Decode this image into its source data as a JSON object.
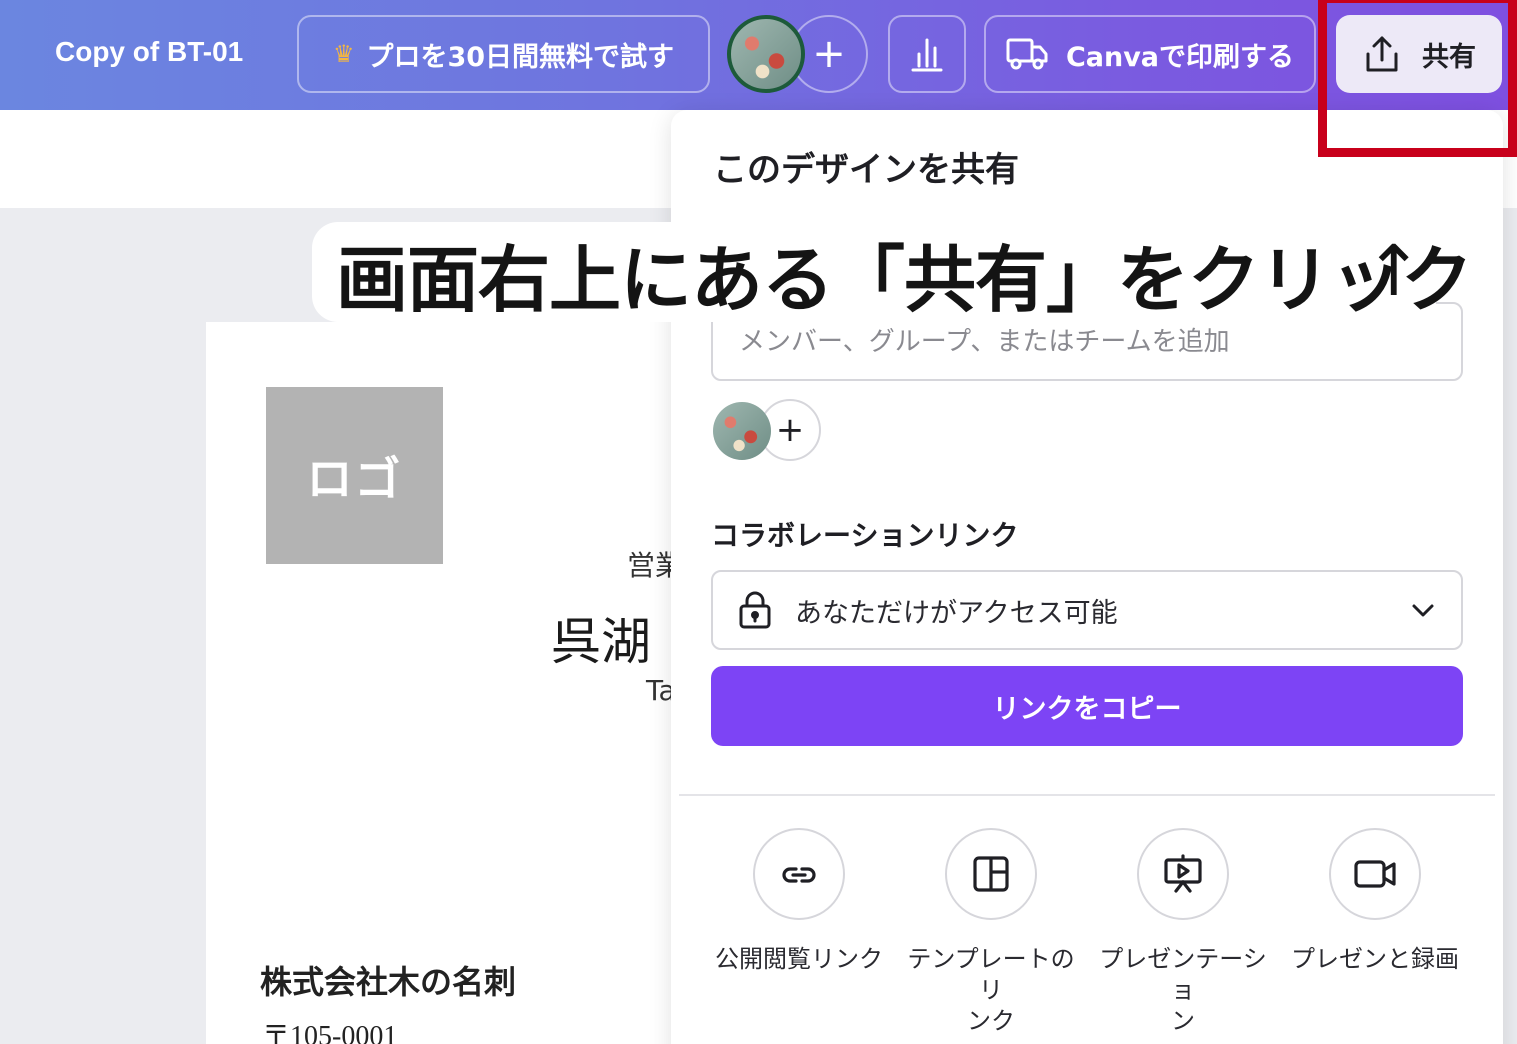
{
  "header": {
    "doc_title": "Copy of BT-01",
    "pro_label": "プロを30日間無料で試す",
    "print_label": "Canvaで印刷する",
    "share_label": "共有",
    "plus": "+"
  },
  "card": {
    "logo_text": "ロゴ",
    "role": "営業",
    "name": "呉湖",
    "romaji": "Ta",
    "company": "株式会社木の名刺",
    "postal": "〒105-0001"
  },
  "share_panel": {
    "title": "このデザインを共有",
    "member_placeholder": "メンバー、グループ、またはチームを追加",
    "collab_label": "コラボレーションリンク",
    "access_value": "あなただけがアクセス可能",
    "copy_link_label": "リンクをコピー",
    "options": [
      {
        "label": "公開閲覧リンク",
        "icon": "link-icon"
      },
      {
        "label": "テンプレートのリンク",
        "icon": "template-icon"
      },
      {
        "label": "プレゼンテーション",
        "icon": "presentation-icon"
      },
      {
        "label": "プレゼンと録画",
        "icon": "video-camera-icon"
      }
    ]
  },
  "overlay": {
    "instruction": "画面右上にある「共有」をクリック",
    "arrow": "↑"
  },
  "colors": {
    "accent_purple": "#7d44f5",
    "highlight_red": "#c8001b",
    "crown_gold": "#f4b740"
  }
}
